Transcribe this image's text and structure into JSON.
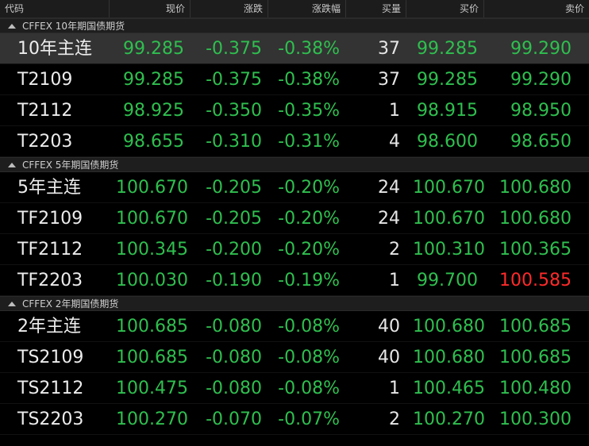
{
  "columns": [
    "代码",
    "现价",
    "涨跌",
    "涨跌幅",
    "买量",
    "买价",
    "卖价"
  ],
  "colors": {
    "down": "#2fbf4f",
    "up": "#ff2a2a",
    "neutral": "#e6e6e6"
  },
  "groups": [
    {
      "title": "CFFEX 10年期国债期货",
      "rows": [
        {
          "code": "10年主连",
          "price": "99.285",
          "change": "-0.375",
          "pct": "-0.38%",
          "bidvol": "37",
          "bid": "99.285",
          "ask": "99.290",
          "ask_color": "green"
        },
        {
          "code": "T2109",
          "price": "99.285",
          "change": "-0.375",
          "pct": "-0.38%",
          "bidvol": "37",
          "bid": "99.285",
          "ask": "99.290",
          "ask_color": "green"
        },
        {
          "code": "T2112",
          "price": "98.925",
          "change": "-0.350",
          "pct": "-0.35%",
          "bidvol": "1",
          "bid": "98.915",
          "ask": "98.950",
          "ask_color": "green"
        },
        {
          "code": "T2203",
          "price": "98.655",
          "change": "-0.310",
          "pct": "-0.31%",
          "bidvol": "4",
          "bid": "98.600",
          "ask": "98.650",
          "ask_color": "green"
        }
      ]
    },
    {
      "title": "CFFEX 5年期国债期货",
      "rows": [
        {
          "code": "5年主连",
          "price": "100.670",
          "change": "-0.205",
          "pct": "-0.20%",
          "bidvol": "24",
          "bid": "100.670",
          "ask": "100.680",
          "ask_color": "green"
        },
        {
          "code": "TF2109",
          "price": "100.670",
          "change": "-0.205",
          "pct": "-0.20%",
          "bidvol": "24",
          "bid": "100.670",
          "ask": "100.680",
          "ask_color": "green"
        },
        {
          "code": "TF2112",
          "price": "100.345",
          "change": "-0.200",
          "pct": "-0.20%",
          "bidvol": "2",
          "bid": "100.310",
          "ask": "100.365",
          "ask_color": "green"
        },
        {
          "code": "TF2203",
          "price": "100.030",
          "change": "-0.190",
          "pct": "-0.19%",
          "bidvol": "1",
          "bid": "99.700",
          "ask": "100.585",
          "ask_color": "red"
        }
      ]
    },
    {
      "title": "CFFEX 2年期国债期货",
      "rows": [
        {
          "code": "2年主连",
          "price": "100.685",
          "change": "-0.080",
          "pct": "-0.08%",
          "bidvol": "40",
          "bid": "100.680",
          "ask": "100.685",
          "ask_color": "green"
        },
        {
          "code": "TS2109",
          "price": "100.685",
          "change": "-0.080",
          "pct": "-0.08%",
          "bidvol": "40",
          "bid": "100.680",
          "ask": "100.685",
          "ask_color": "green"
        },
        {
          "code": "TS2112",
          "price": "100.475",
          "change": "-0.080",
          "pct": "-0.08%",
          "bidvol": "1",
          "bid": "100.465",
          "ask": "100.480",
          "ask_color": "green"
        },
        {
          "code": "TS2203",
          "price": "100.270",
          "change": "-0.070",
          "pct": "-0.07%",
          "bidvol": "2",
          "bid": "100.270",
          "ask": "100.300",
          "ask_color": "green"
        }
      ]
    }
  ]
}
